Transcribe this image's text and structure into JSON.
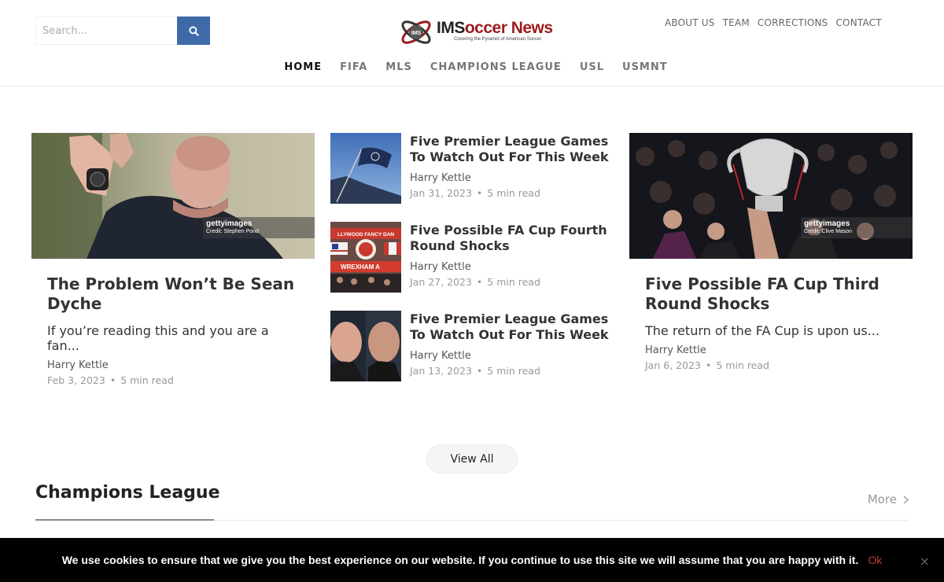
{
  "header": {
    "search": {
      "placeholder": "Search...",
      "value": ""
    },
    "logo": {
      "ims": "IMS",
      "rest": "occer News",
      "tagline": "Covering the Pyramid of American Soccer",
      "badge": "IMS"
    },
    "top_links": [
      "ABOUT US",
      "TEAM",
      "CORRECTIONS",
      "CONTACT"
    ],
    "main_nav": [
      "HOME",
      "FIFA",
      "MLS",
      "CHAMPIONS LEAGUE",
      "USL",
      "USMNT"
    ],
    "active_nav": "HOME"
  },
  "featured": [
    {
      "title": "The Problem Won’t Be Sean Dyche",
      "excerpt": "If you’re reading this and you are a fan...",
      "author": "Harry Kettle",
      "date": "Feb 3, 2023",
      "read": "5 min read",
      "getty": "gettyimages",
      "credit": "Credit: Stephen Pond"
    },
    {
      "title": "Five Possible FA Cup Third Round Shocks",
      "excerpt": "The return of the FA Cup is upon us...",
      "author": "Harry Kettle",
      "date": "Jan 6, 2023",
      "read": "5 min read",
      "getty": "gettyimages",
      "credit": "Credit: Clive Mason"
    }
  ],
  "small": [
    {
      "title": "Five Premier League Games To Watch Out For This Week",
      "author": "Harry Kettle",
      "date": "Jan 31, 2023",
      "read": "5 min read"
    },
    {
      "title": "Five Possible FA Cup Fourth Round Shocks",
      "author": "Harry Kettle",
      "date": "Jan 27, 2023",
      "read": "5 min read",
      "banner": "LLYWOOD FANCY DAN",
      "banner2": "WREXHAM A"
    },
    {
      "title": "Five Premier League Games To Watch Out For This Week",
      "author": "Harry Kettle",
      "date": "Jan 13, 2023",
      "read": "5 min read"
    }
  ],
  "view_all": "View All",
  "section": {
    "title": "Champions League",
    "more": "More"
  },
  "cookie": {
    "message": "We use cookies to ensure that we give you the best experience on our website. If you continue to use this site we will assume that you are happy with it.",
    "ok": "Ok",
    "close": "×"
  },
  "meta_separator": "•",
  "colors": {
    "accent": "#3e6aa8",
    "brand_red": "#9b1b1b",
    "cookie_ok": "#c0392b"
  }
}
